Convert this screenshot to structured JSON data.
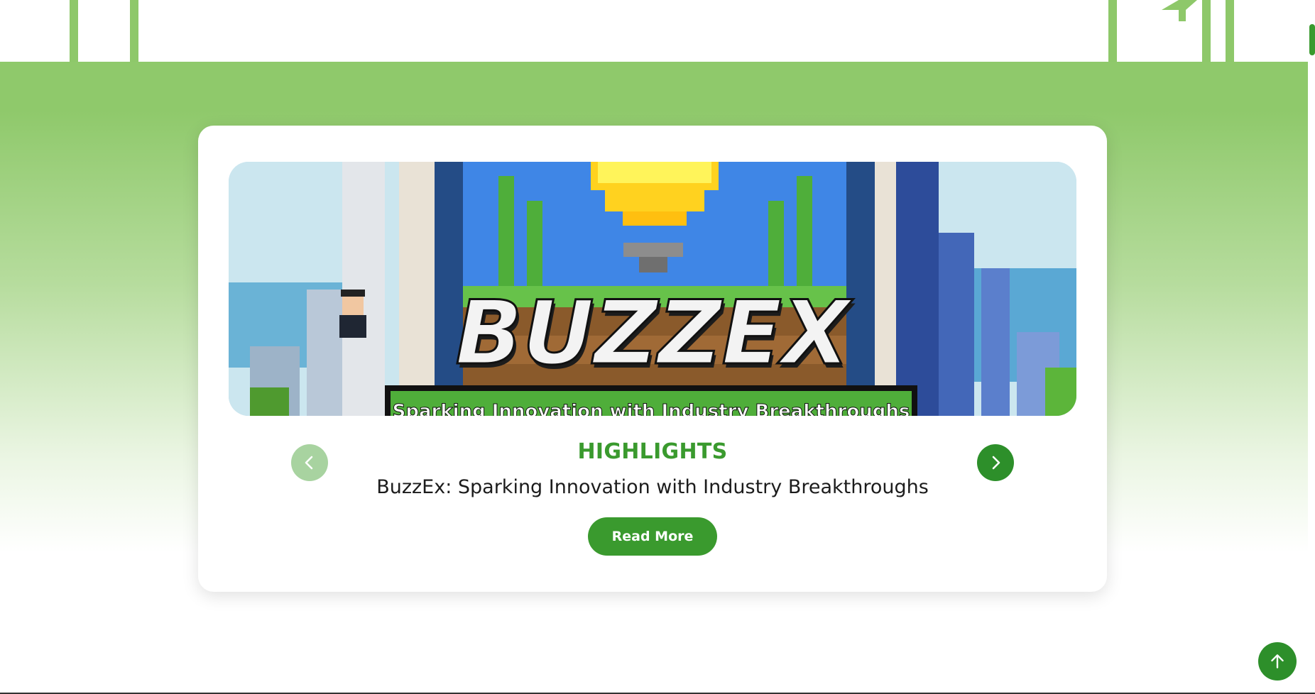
{
  "highlight": {
    "section_label": "HIGHLIGHTS",
    "article_title": "BuzzEx: Sparking Innovation with Industry Breakthroughs",
    "read_more_label": "Read More",
    "banner": {
      "logo_text": "BUZZEX",
      "subtitle_text": "Sparking Innovation with Industry Breakthroughs"
    }
  },
  "icons": {
    "prev": "chevron-left-icon",
    "next": "chevron-right-icon",
    "back_to_top": "arrow-up-icon"
  },
  "colors": {
    "brand_green": "#3a9a2e",
    "hero_green": "#8fc96b",
    "nav_disabled": "#a8d3a0"
  }
}
